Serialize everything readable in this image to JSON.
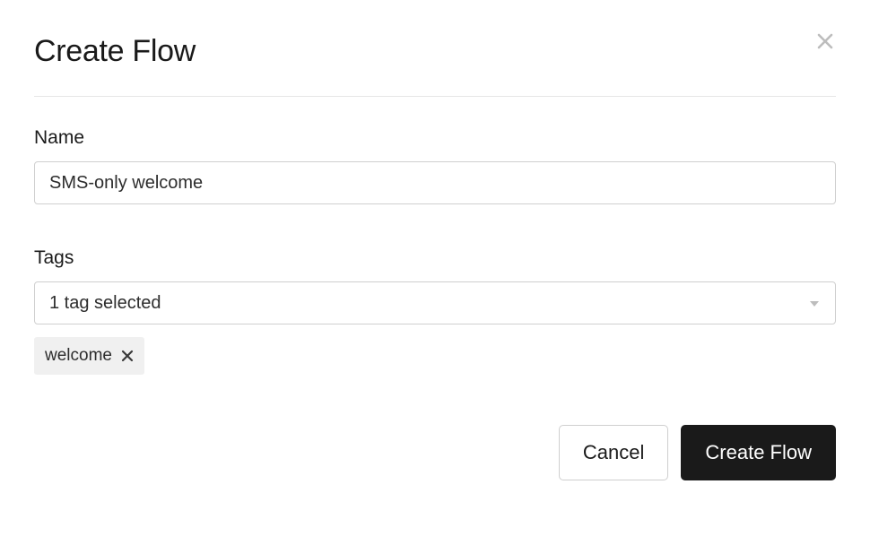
{
  "modal": {
    "title": "Create Flow"
  },
  "form": {
    "name": {
      "label": "Name",
      "value": "SMS-only welcome"
    },
    "tags": {
      "label": "Tags",
      "selected_text": "1 tag selected",
      "chips": [
        {
          "label": "welcome"
        }
      ]
    }
  },
  "buttons": {
    "cancel": "Cancel",
    "submit": "Create Flow"
  }
}
